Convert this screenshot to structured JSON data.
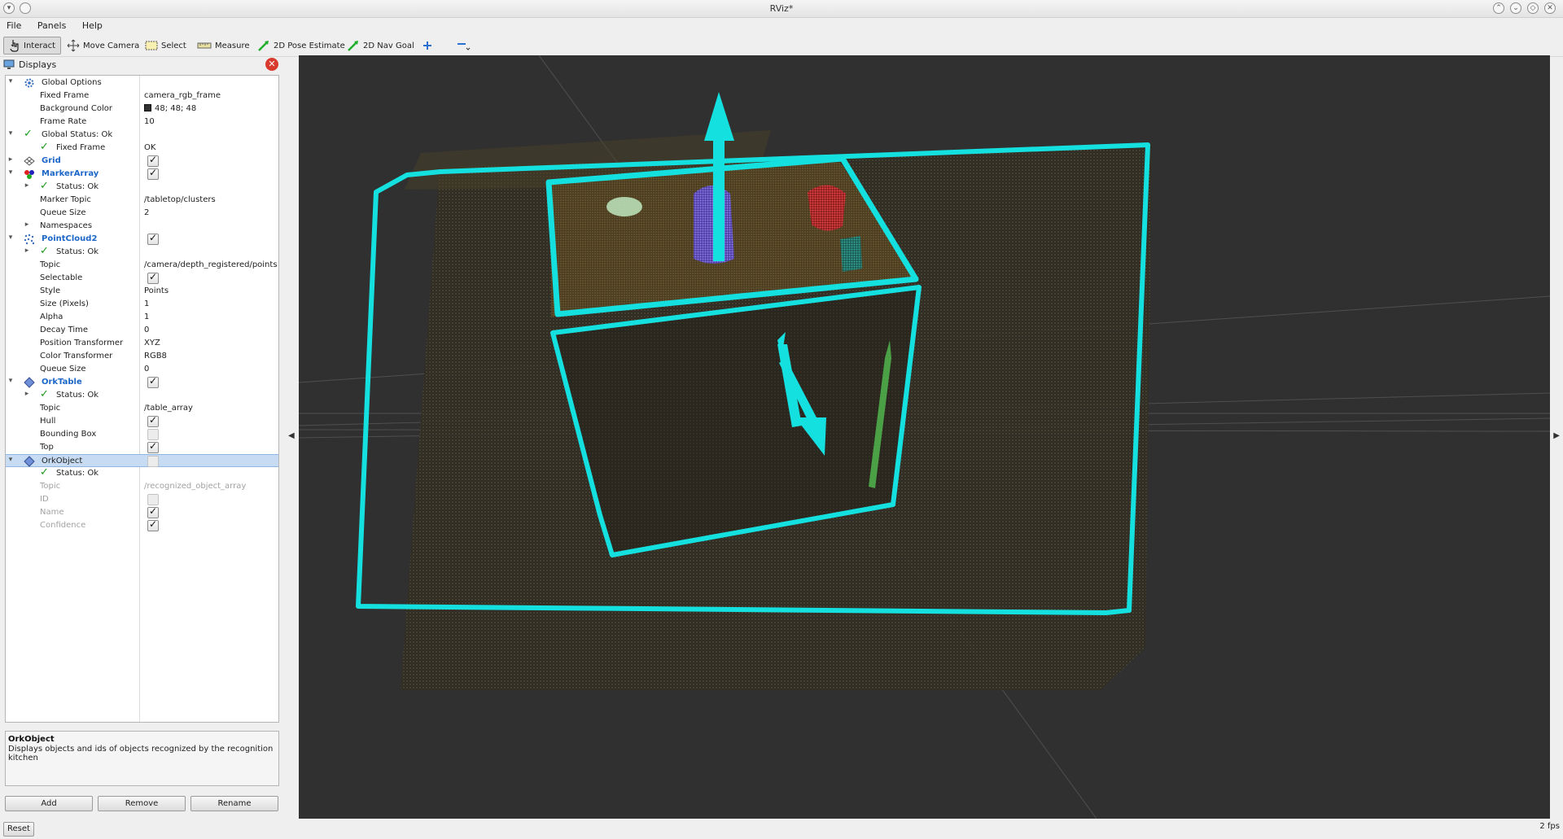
{
  "window": {
    "title": "RViz*"
  },
  "menu": [
    "File",
    "Panels",
    "Help"
  ],
  "toolbar": {
    "tools": [
      {
        "label": "Interact",
        "icon": "hand-pointer-icon"
      },
      {
        "label": "Move Camera",
        "icon": "move-camera-icon"
      },
      {
        "label": "Select",
        "icon": "select-box-icon"
      },
      {
        "label": "Measure",
        "icon": "ruler-icon"
      },
      {
        "label": "2D Pose Estimate",
        "icon": "green-arrow-icon"
      },
      {
        "label": "2D Nav Goal",
        "icon": "green-arrow-icon"
      }
    ]
  },
  "displays_panel": {
    "title": "Displays",
    "tree": {
      "global_options": {
        "label": "Global Options"
      },
      "fixed_frame": {
        "label": "Fixed Frame",
        "value": "camera_rgb_frame"
      },
      "background_color": {
        "label": "Background Color",
        "value": "48; 48; 48"
      },
      "frame_rate": {
        "label": "Frame Rate",
        "value": "10"
      },
      "global_status": {
        "label": "Global Status: Ok"
      },
      "global_fixed_frame": {
        "label": "Fixed Frame",
        "value": "OK"
      },
      "grid": {
        "label": "Grid",
        "enabled": true
      },
      "marker_array": {
        "label": "MarkerArray",
        "enabled": true
      },
      "ma_status": {
        "label": "Status: Ok"
      },
      "ma_marker_topic": {
        "label": "Marker Topic",
        "value": "/tabletop/clusters"
      },
      "ma_queue_size": {
        "label": "Queue Size",
        "value": "2"
      },
      "ma_namespaces": {
        "label": "Namespaces"
      },
      "point_cloud": {
        "label": "PointCloud2",
        "enabled": true
      },
      "pc_status": {
        "label": "Status: Ok"
      },
      "pc_topic": {
        "label": "Topic",
        "value": "/camera/depth_registered/points"
      },
      "pc_selectable": {
        "label": "Selectable",
        "enabled": true
      },
      "pc_style": {
        "label": "Style",
        "value": "Points"
      },
      "pc_size": {
        "label": "Size (Pixels)",
        "value": "1"
      },
      "pc_alpha": {
        "label": "Alpha",
        "value": "1"
      },
      "pc_decay": {
        "label": "Decay Time",
        "value": "0"
      },
      "pc_position_transformer": {
        "label": "Position Transformer",
        "value": "XYZ"
      },
      "pc_color_transformer": {
        "label": "Color Transformer",
        "value": "RGB8"
      },
      "pc_queue_size": {
        "label": "Queue Size",
        "value": "0"
      },
      "ork_table": {
        "label": "OrkTable",
        "enabled": true
      },
      "ot_status": {
        "label": "Status: Ok"
      },
      "ot_topic": {
        "label": "Topic",
        "value": "/table_array"
      },
      "ot_hull": {
        "label": "Hull",
        "enabled": true
      },
      "ot_bbox": {
        "label": "Bounding Box",
        "enabled": false
      },
      "ot_top": {
        "label": "Top",
        "enabled": true
      },
      "ork_object": {
        "label": "OrkObject",
        "enabled": false
      },
      "oo_status": {
        "label": "Status: Ok"
      },
      "oo_topic": {
        "label": "Topic",
        "value": "/recognized_object_array"
      },
      "oo_id": {
        "label": "ID",
        "enabled": false
      },
      "oo_name": {
        "label": "Name",
        "enabled": true
      },
      "oo_confidence": {
        "label": "Confidence",
        "enabled": true
      }
    },
    "description": {
      "title": "OrkObject",
      "text": "Displays objects and ids of objects recognized by the recognition kitchen"
    },
    "buttons": {
      "add": "Add",
      "remove": "Remove",
      "rename": "Rename"
    }
  },
  "statusbar": {
    "reset": "Reset",
    "fps": "2 fps"
  },
  "colors": {
    "viewport_bg": "#303030",
    "hull": "#15e0e0",
    "accent_blue": "#1c67c8"
  }
}
